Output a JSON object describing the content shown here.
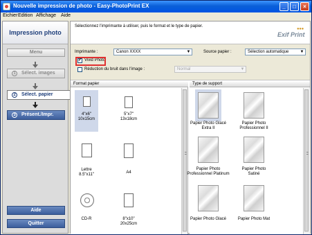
{
  "window": {
    "title": "Nouvelle impression de photo - Easy-PhotoPrint EX"
  },
  "menu": [
    "Eichier",
    "Edition",
    "Affichage",
    "Aide"
  ],
  "sidebar": {
    "header": "Impression photo",
    "menu_button": "Menu",
    "steps": [
      {
        "num": "1",
        "label": "Sélect. images",
        "state": "disabled"
      },
      {
        "num": "2",
        "label": "Sélect. papier",
        "state": "active"
      },
      {
        "num": "3",
        "label": "Présent./Impr.",
        "state": "next"
      }
    ],
    "help_button": "Aide",
    "quit_button": "Quitter"
  },
  "main": {
    "instruction": "Sélectionnez l'imprimante à utiliser, puis le format et le type de papier.",
    "logo_text": "Exif Print",
    "printer_label": "Imprimante :",
    "printer_value": "Canon XXXX",
    "source_label": "Source papier :",
    "source_value": "Sélection automatique",
    "vivid_label": "Vivid Photo",
    "vivid_checked": true,
    "noise_label": "Réduction du bruit dans l'image :",
    "noise_checked": false,
    "noise_value": "Normal"
  },
  "paper_format": {
    "header": "Format papier",
    "items": [
      {
        "label": "4\"x6\"\n10x15cm",
        "selected": true
      },
      {
        "label": "5\"x7\"\n13x18cm",
        "selected": false
      },
      {
        "label": "Lettre\n8.5\"x11\"",
        "selected": false
      },
      {
        "label": "A4",
        "selected": false
      },
      {
        "label": "CD-R",
        "selected": false
      },
      {
        "label": "8\"x10\"\n20x25cm",
        "selected": false
      }
    ]
  },
  "media_type": {
    "header": "Type de support",
    "items": [
      {
        "label": "Papier Photo Glacé\nExtra II",
        "selected": true
      },
      {
        "label": "Papier Photo\nProfessionnel II",
        "selected": false
      },
      {
        "label": "Papier Photo\nProfessionnel Platinum",
        "selected": false
      },
      {
        "label": "Papier Photo\nSatiné",
        "selected": false
      },
      {
        "label": "Papier Photo Glacé",
        "selected": false
      },
      {
        "label": "Papier Photo Mat",
        "selected": false
      }
    ]
  },
  "colors": {
    "title_bar": "#0054e3",
    "accent": "#3c5e9c",
    "selection": "#cfd8ea",
    "highlight_box": "#e03030"
  }
}
